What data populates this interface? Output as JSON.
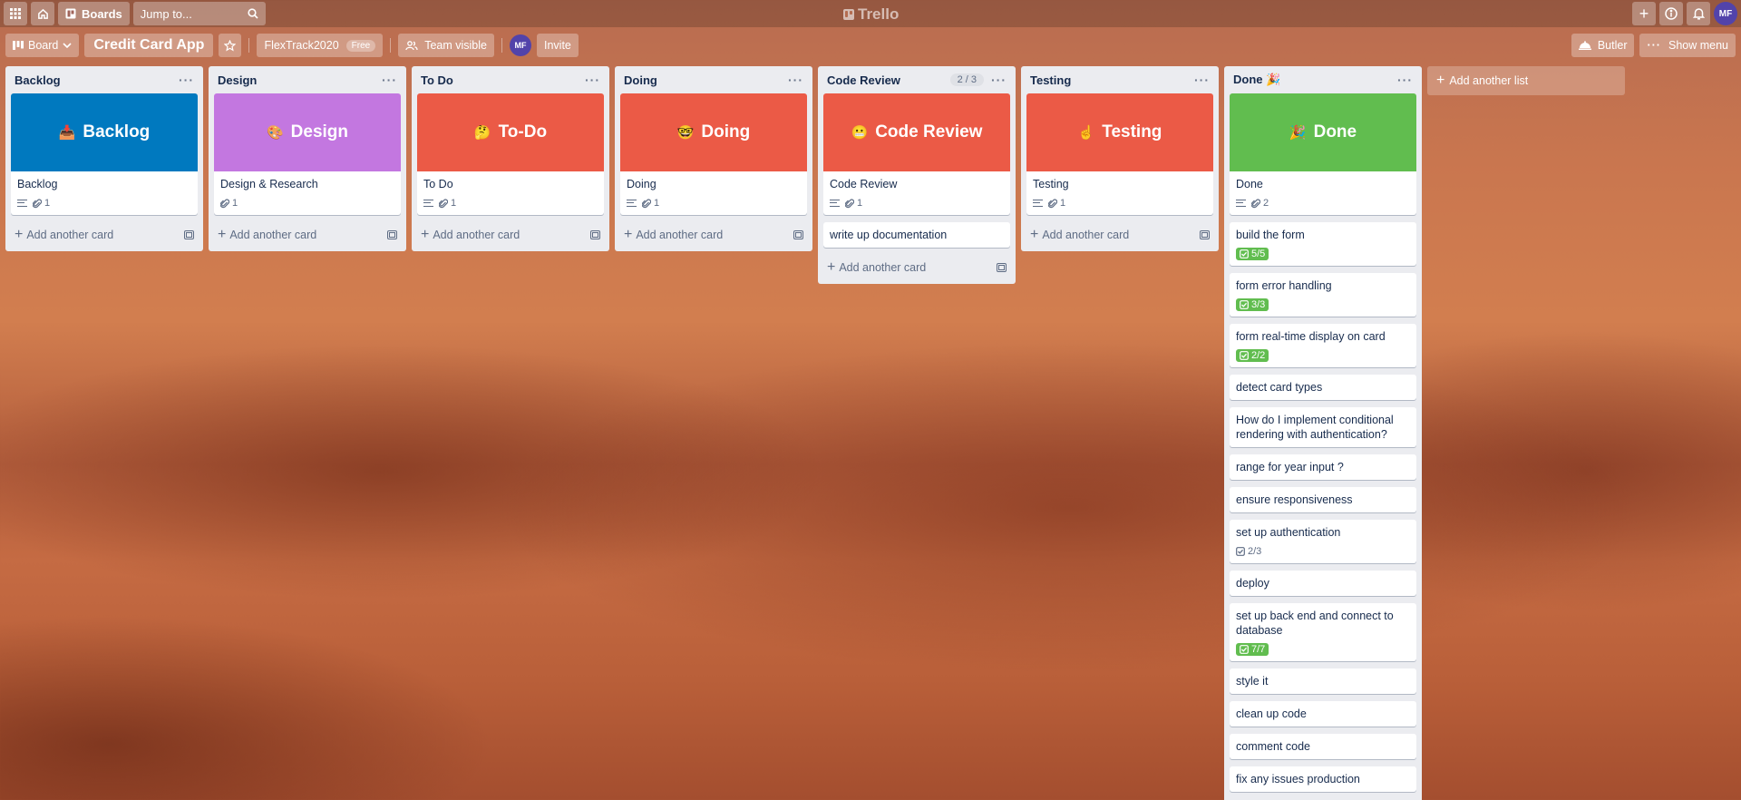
{
  "topbar": {
    "boards_label": "Boards",
    "search_placeholder": "Jump to...",
    "logo": "Trello",
    "avatar": "MF"
  },
  "boardbar": {
    "view_label": "Board",
    "title": "Credit Card App",
    "team_name": "FlexTrack2020",
    "team_plan": "Free",
    "visibility": "Team visible",
    "member_avatar": "MF",
    "invite_label": "Invite",
    "butler_label": "Butler",
    "show_menu_label": "Show menu"
  },
  "add_card_label": "Add another card",
  "add_list_label": "Add another list",
  "lists": [
    {
      "title": "Backlog",
      "cards": [
        {
          "cover": {
            "emoji": "📥",
            "text": "Backlog",
            "color": "#0079bf"
          },
          "title": "Backlog",
          "has_desc": true,
          "attachments": "1"
        }
      ]
    },
    {
      "title": "Design",
      "cards": [
        {
          "cover": {
            "emoji": "🎨",
            "text": "Design",
            "color": "#c377e0"
          },
          "title": "Design & Research",
          "has_desc": false,
          "attachments": "1"
        }
      ]
    },
    {
      "title": "To Do",
      "cards": [
        {
          "cover": {
            "emoji": "🤔",
            "text": "To-Do",
            "color": "#eb5a46"
          },
          "title": "To Do",
          "has_desc": true,
          "attachments": "1"
        }
      ]
    },
    {
      "title": "Doing",
      "cards": [
        {
          "cover": {
            "emoji": "🤓",
            "text": "Doing",
            "color": "#eb5a46"
          },
          "title": "Doing",
          "has_desc": true,
          "attachments": "1"
        }
      ]
    },
    {
      "title": "Code Review",
      "wip": "2 / 3",
      "cards": [
        {
          "cover": {
            "emoji": "😬",
            "text": "Code Review",
            "color": "#eb5a46"
          },
          "title": "Code Review",
          "has_desc": true,
          "attachments": "1"
        },
        {
          "title": "write up documentation"
        }
      ]
    },
    {
      "title": "Testing",
      "cards": [
        {
          "cover": {
            "emoji": "☝️",
            "text": "Testing",
            "color": "#eb5a46"
          },
          "title": "Testing",
          "has_desc": true,
          "attachments": "1"
        }
      ]
    },
    {
      "title": "Done 🎉",
      "cards": [
        {
          "cover": {
            "emoji": "🎉",
            "text": "Done",
            "color": "#61bd4f"
          },
          "title": "Done",
          "has_desc": true,
          "attachments": "2"
        },
        {
          "title": "build the form",
          "checklist": "5/5",
          "complete": true
        },
        {
          "title": "form error handling",
          "checklist": "3/3",
          "complete": true
        },
        {
          "title": "form real-time display on card",
          "checklist": "2/2",
          "complete": true
        },
        {
          "title": "detect card types"
        },
        {
          "title": "How do I implement conditional rendering with authentication?"
        },
        {
          "title": "range for year input ?"
        },
        {
          "title": "ensure responsiveness"
        },
        {
          "title": "set up authentication",
          "checklist": "2/3",
          "complete": false
        },
        {
          "title": "deploy"
        },
        {
          "title": "set up back end and connect to database",
          "checklist": "7/7",
          "complete": true
        },
        {
          "title": "style it"
        },
        {
          "title": "clean up code"
        },
        {
          "title": "comment code"
        },
        {
          "title": "fix any issues production"
        }
      ]
    }
  ]
}
